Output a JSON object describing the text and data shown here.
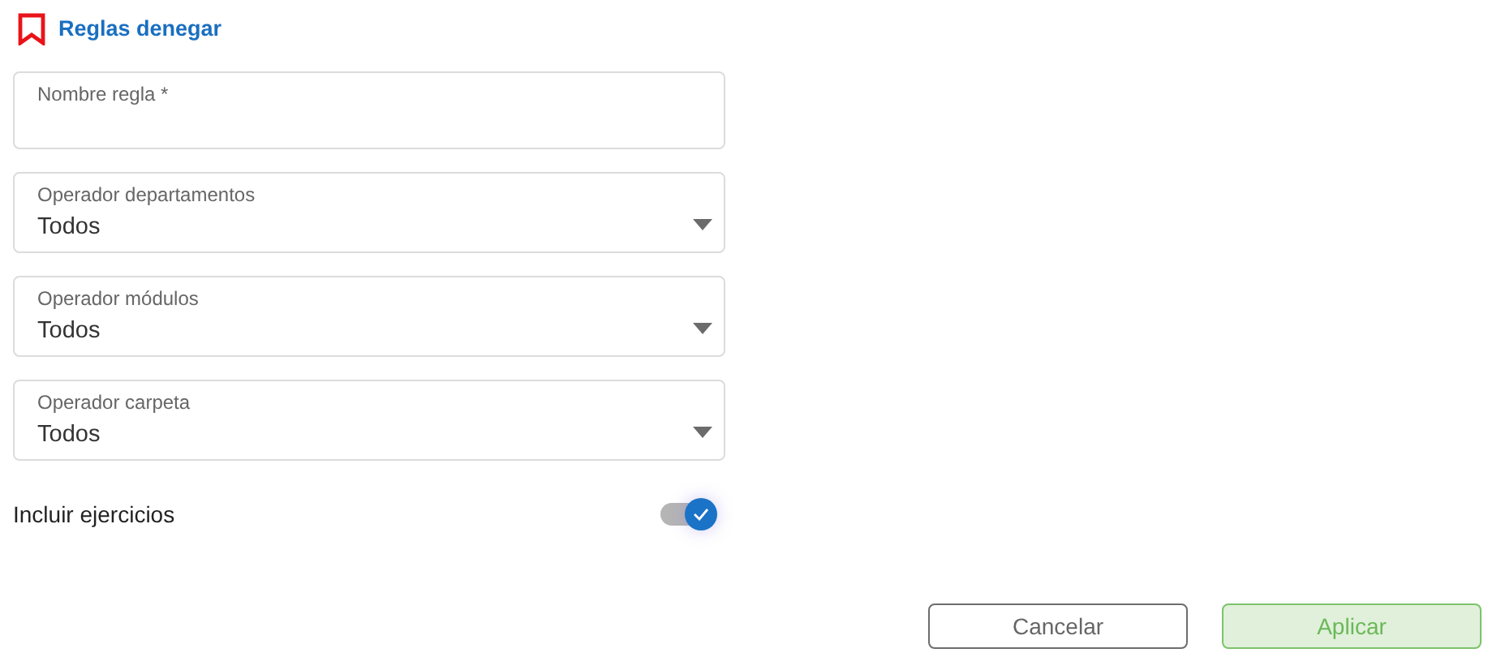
{
  "header": {
    "title": "Reglas denegar"
  },
  "fields": [
    {
      "kind": "text",
      "label": "Nombre regla *"
    },
    {
      "kind": "select",
      "label": "Operador departamentos",
      "value": "Todos"
    },
    {
      "kind": "select",
      "label": "Operador módulos",
      "value": "Todos"
    },
    {
      "kind": "select",
      "label": "Operador carpeta",
      "value": "Todos"
    }
  ],
  "toggle": {
    "label": "Incluir ejercicios",
    "on": true
  },
  "buttons": [
    {
      "kind": "secondary",
      "label": "Cancelar"
    },
    {
      "kind": "primary",
      "label": "Aplicar"
    }
  ]
}
